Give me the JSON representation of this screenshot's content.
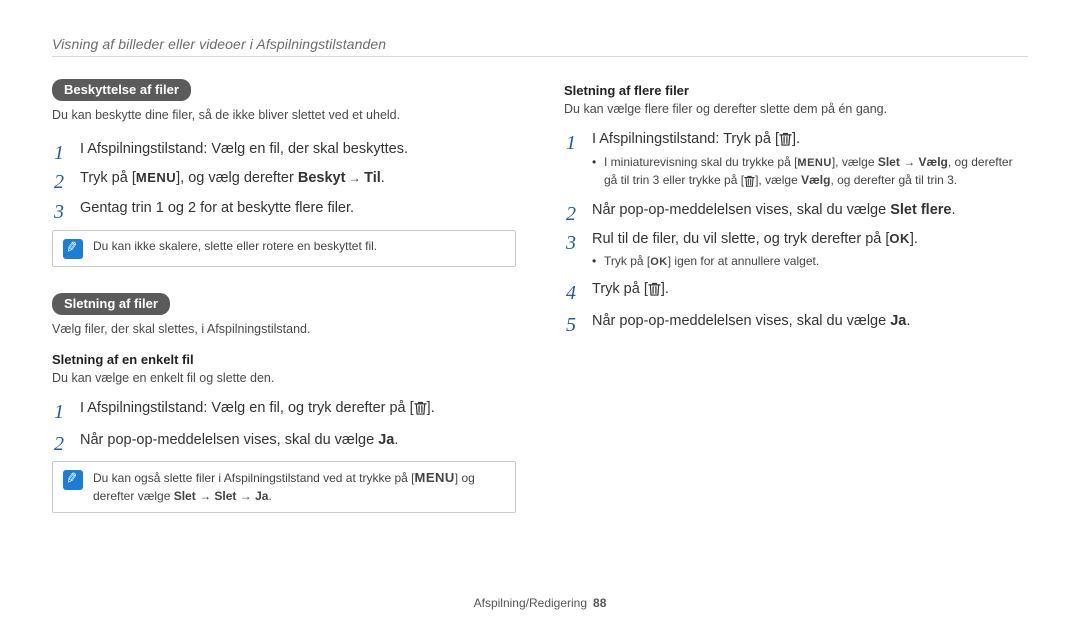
{
  "header": {
    "title": "Visning af billeder eller videoer i Afspilningstilstanden"
  },
  "left": {
    "section1": {
      "pill": "Beskyttelse af filer",
      "intro": "Du kan beskytte dine filer, så de ikke bliver slettet ved et uheld.",
      "steps": {
        "s1": "I Afspilningstilstand: Vælg en fil, der skal beskyttes.",
        "s2_pre": "Tryk på [",
        "s2_mid": "], og vælg derefter ",
        "s2_bold1": "Beskyt",
        "s2_arrow": " → ",
        "s2_bold2": "Til",
        "s2_end": ".",
        "s3": "Gentag trin 1 og 2 for at beskytte flere filer."
      },
      "note": "Du kan ikke skalere, slette eller rotere en beskyttet fil."
    },
    "section2": {
      "pill": "Sletning af filer",
      "intro": "Vælg filer, der skal slettes, i Afspilningstilstand.",
      "sub_heading": "Sletning af en enkelt fil",
      "sub_intro": "Du kan vælge en enkelt fil og slette den.",
      "steps": {
        "s1_pre": "I Afspilningstilstand: Vælg en fil, og tryk derefter på [",
        "s1_end": "].",
        "s2_pre": "Når pop-op-meddelelsen vises, skal du vælge ",
        "s2_bold": "Ja",
        "s2_end": "."
      },
      "note_pre": "Du kan også slette filer i Afspilningstilstand ved at trykke på [",
      "note_mid": "] og derefter vælge ",
      "note_b1": "Slet",
      "note_arrow1": " → ",
      "note_b2": "Slet",
      "note_arrow2": " → ",
      "note_b3": "Ja",
      "note_end": "."
    }
  },
  "right": {
    "sub_heading": "Sletning af flere filer",
    "intro": "Du kan vælge flere filer og derefter slette dem på én gang.",
    "steps": {
      "s1_pre": "I Afspilningstilstand: Tryk på [",
      "s1_end": "].",
      "s1_bullet_pre": "I miniaturevisning skal du trykke på [",
      "s1_bullet_mid1": "], vælge ",
      "s1_bullet_b1": "Slet",
      "s1_bullet_arrow": " → ",
      "s1_bullet_b2": "Vælg",
      "s1_bullet_mid2": ", og derefter gå til trin 3 eller trykke på [",
      "s1_bullet_mid3": "], vælge ",
      "s1_bullet_b3": "Vælg",
      "s1_bullet_end": ", og derefter gå til trin 3.",
      "s2_pre": "Når pop-op-meddelelsen vises, skal du vælge ",
      "s2_bold": "Slet flere",
      "s2_end": ".",
      "s3_pre": "Rul til de filer, du vil slette, og tryk derefter på [",
      "s3_end": "].",
      "s3_bullet_pre": "Tryk på [",
      "s3_bullet_end": "] igen for at annullere valget.",
      "s4_pre": "Tryk på [",
      "s4_end": "].",
      "s5_pre": "Når pop-op-meddelelsen vises, skal du vælge ",
      "s5_bold": "Ja",
      "s5_end": "."
    }
  },
  "footer": {
    "label": "Afspilning/Redigering",
    "page": "88"
  },
  "keys": {
    "menu": "MENU",
    "ok": "OK"
  }
}
